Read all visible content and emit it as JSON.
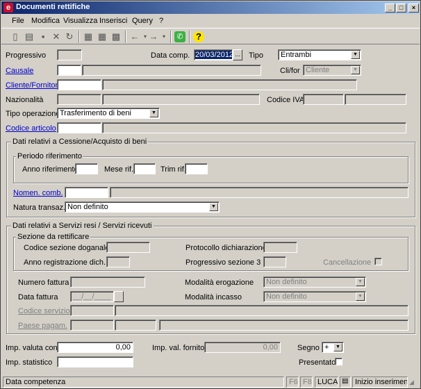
{
  "window": {
    "title": "Documenti rettifiche"
  },
  "menu": [
    "File",
    "Modifica",
    "Visualizza",
    "Inserisci",
    "Query",
    "?"
  ],
  "labels": {
    "progressivo": "Progressivo",
    "data_comp": "Data comp.",
    "tipo": "Tipo",
    "causale": "Causale",
    "clifor": "Cli/for",
    "cliente_fornitore": "Cliente/Fornitore",
    "nazionalita": "Nazionalità",
    "codice_iva": "Codice IVA",
    "tipo_operazione": "Tipo operazione",
    "codice_articolo": "Codice articolo",
    "anno_rif": "Anno riferimento",
    "mese_rif": "Mese rif.",
    "trim_rif": "Trim rif.",
    "nomen_comb": "Nomen. comb.",
    "natura_transaz": "Natura transaz.",
    "codice_sezione_doganale": "Codice sezione doganale",
    "protocollo_dichiarazione": "Protocollo dichiarazione",
    "anno_registrazione_dich": "Anno registrazione dich.",
    "progressivo_sezione_3": "Progressivo sezione 3",
    "cancellazione": "Cancellazione",
    "numero_fattura": "Numero fattura",
    "modalita_erogazione": "Modalità erogazione",
    "data_fattura": "Data fattura",
    "modalita_incasso": "Modalità incasso",
    "codice_servizio": "Codice servizio",
    "paese_pagam": "Paese pagam.",
    "imp_valuta_con": "Imp. valuta con.",
    "imp_val_fornitore": "Imp. val. fornitore",
    "segno": "Segno",
    "imp_statistico": "Imp. statistico",
    "presentato": "Presentato"
  },
  "groups": {
    "cessione": "Dati relativi a Cessione/Acquisto di beni",
    "periodo": "Periodo riferimento",
    "servizi": "Dati relativi a Servizi resi / Servizi ricevuti",
    "sezione": "Sezione da rettificare"
  },
  "values": {
    "data_comp": "20/03/2012",
    "tipo": "Entrambi",
    "clifor": "Cliente",
    "tipo_operazione": "Trasferimento di beni",
    "natura_transaz": "Non definito",
    "modalita_erogazione": "Non definito",
    "modalita_incasso": "Non definito",
    "data_fattura": "__/__/____",
    "imp_valuta_con": "0,00",
    "imp_val_fornitore": "0,00",
    "segno": "+",
    "date_btn": "..."
  },
  "status": {
    "text": "Data competenza",
    "f6": "F6",
    "f8": "F8",
    "user": "LUCA",
    "mode": "Inizio inserimento..."
  }
}
